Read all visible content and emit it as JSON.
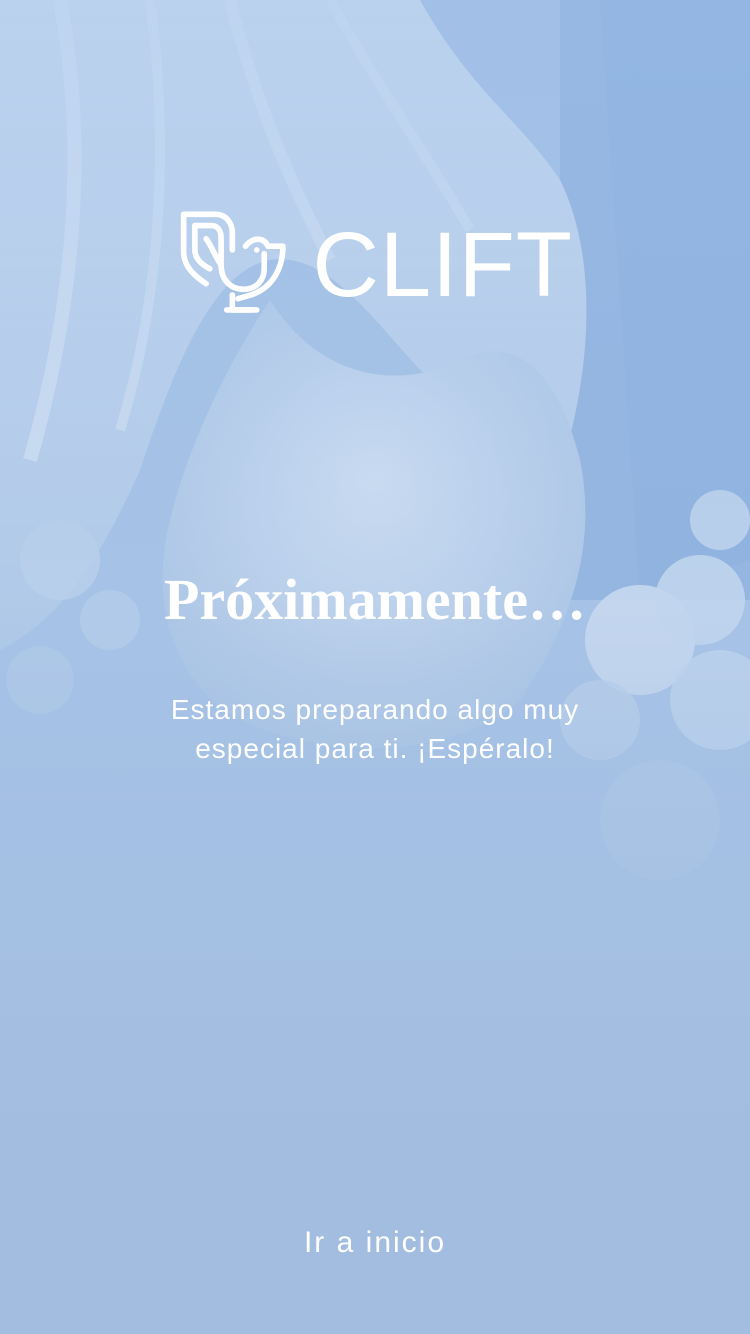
{
  "brand": {
    "name": "CLIFT",
    "logo_icon": "bird-logo-icon"
  },
  "main": {
    "title": "Próximamente…",
    "subtitle": "Estamos preparando algo muy especial para ti. ¡Espéralo!"
  },
  "footer": {
    "home_link_label": "Ir a inicio"
  },
  "colors": {
    "background_tint": "#a3bde0",
    "text": "#ffffff"
  }
}
